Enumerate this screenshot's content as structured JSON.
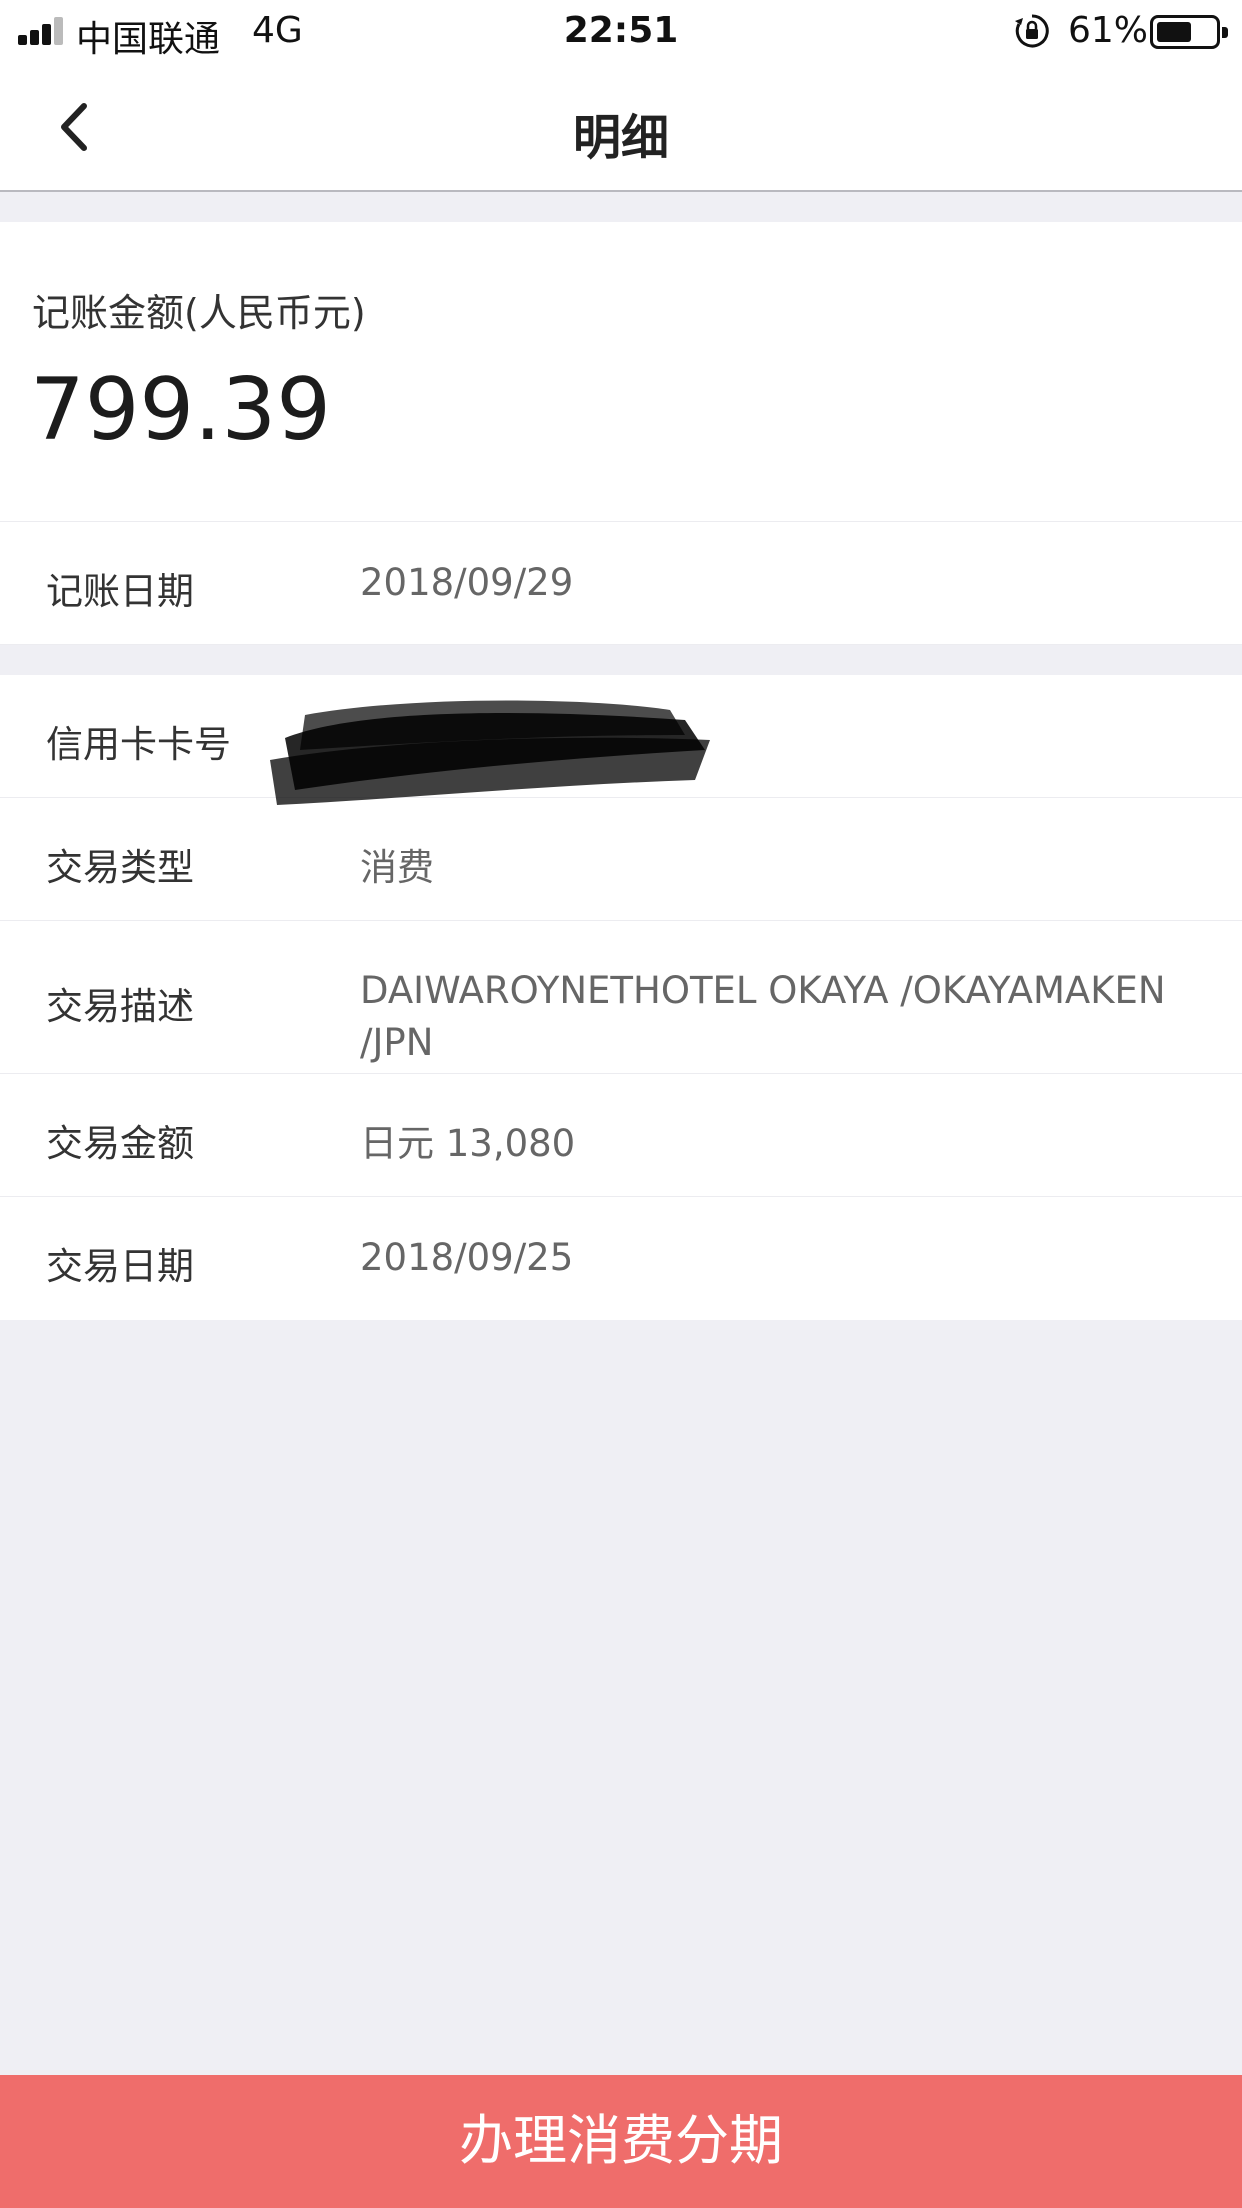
{
  "status_bar": {
    "carrier": "中国联通",
    "network": "4G",
    "time": "22:51",
    "battery_percent": "61%",
    "battery_level": 0.61
  },
  "nav": {
    "title": "明细",
    "back_icon": "chevron-left-icon"
  },
  "summary": {
    "amount_label": "记账金额(人民币元)",
    "amount_value": "799.39"
  },
  "details": {
    "posting_date": {
      "label": "记账日期",
      "value": "2018/09/29"
    },
    "card_number": {
      "label": "信用卡卡号",
      "value": ""
    },
    "transaction_type": {
      "label": "交易类型",
      "value": "消费"
    },
    "transaction_description": {
      "label": "交易描述",
      "value": "DAIWAROYNETHOTEL OKAYA /OKAYAMAKEN /JPN"
    },
    "transaction_amount": {
      "label": "交易金额",
      "value": "日元 13,080"
    },
    "transaction_date": {
      "label": "交易日期",
      "value": "2018/09/25"
    }
  },
  "actions": {
    "installment_button_label": "办理消费分期"
  },
  "colors": {
    "accent": "#ef6d6b",
    "background": "#efeff4"
  }
}
